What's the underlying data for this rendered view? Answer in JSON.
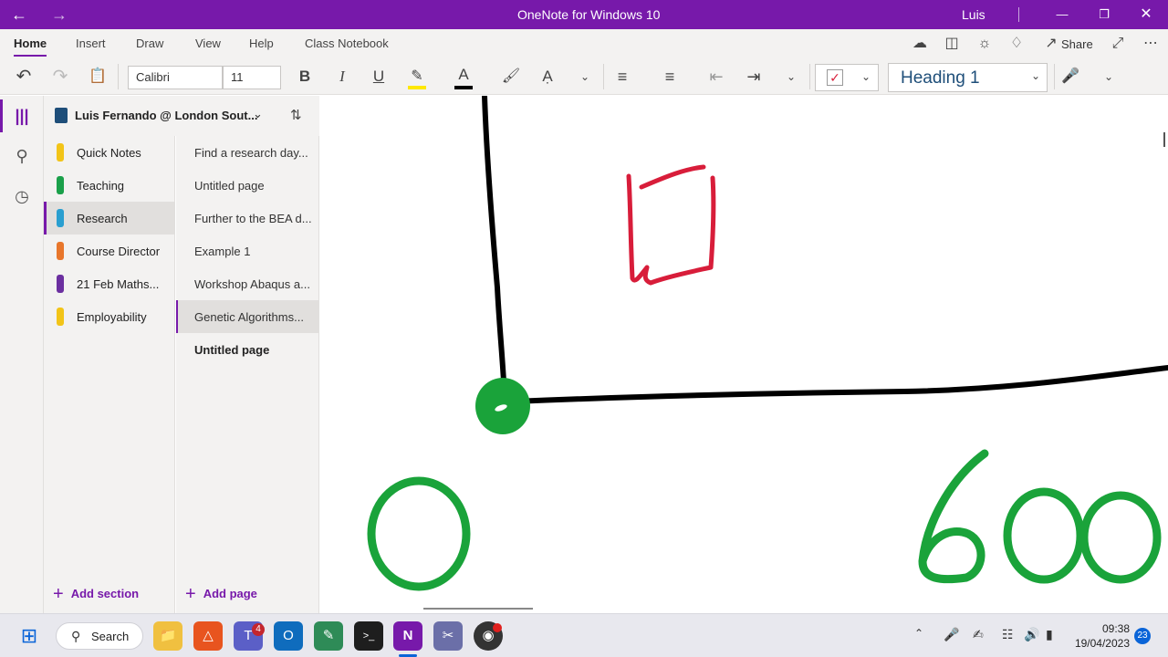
{
  "window": {
    "title": "OneNote for Windows 10",
    "user": "Luis"
  },
  "ribbon": {
    "tabs": [
      "Home",
      "Insert",
      "Draw",
      "View",
      "Help",
      "Class Notebook"
    ],
    "active_tab": "Home",
    "share_label": "Share",
    "font_name": "Calibri",
    "font_size": "11",
    "style": "Heading 1"
  },
  "notebook": {
    "name": "Luis Fernando @ London Sout..."
  },
  "sections": [
    {
      "label": "Quick Notes",
      "color": "#f2c418"
    },
    {
      "label": "Teaching",
      "color": "#1aa04a"
    },
    {
      "label": "Research",
      "color": "#2a9fd0"
    },
    {
      "label": "Course Director",
      "color": "#e8762b"
    },
    {
      "label": "21 Feb Maths...",
      "color": "#6b2fa0"
    },
    {
      "label": "Employability",
      "color": "#f2c418"
    }
  ],
  "selected_section": "Research",
  "pages": [
    "Find a research day...",
    "Untitled page",
    "Further to the BEA d...",
    "Example 1",
    "Workshop Abaqus a...",
    "Genetic Algorithms...",
    "Untitled page"
  ],
  "selected_page": "Genetic Algorithms...",
  "add_section_label": "Add section",
  "add_page_label": "Add page",
  "canvas": {
    "ink_label_left": "0",
    "ink_label_right": "600"
  },
  "taskbar": {
    "search_label": "Search",
    "teams_badge": "4",
    "time": "09:38",
    "date": "19/04/2023",
    "notifications": "23"
  },
  "colors": {
    "accent": "#7719aa",
    "ink_black": "#000000",
    "ink_red": "#d81d3a",
    "ink_green": "#1aa33a"
  }
}
